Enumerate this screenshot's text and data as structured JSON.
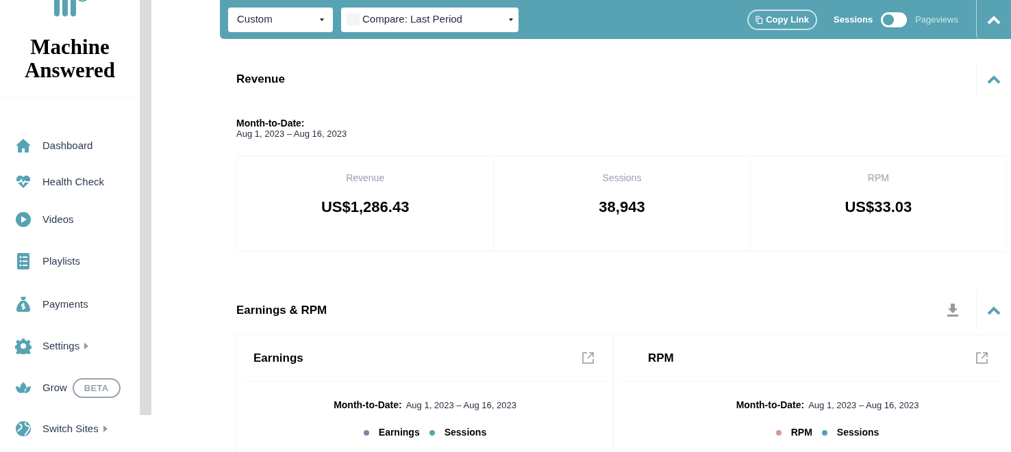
{
  "sidebar": {
    "logo_text": "Machine Answered",
    "items": [
      {
        "label": "Dashboard",
        "submenu": false
      },
      {
        "label": "Health Check",
        "submenu": false
      },
      {
        "label": "Videos",
        "submenu": false
      },
      {
        "label": "Playlists",
        "submenu": false
      },
      {
        "label": "Payments",
        "submenu": false
      },
      {
        "label": "Settings",
        "submenu": true
      },
      {
        "label": "Grow",
        "submenu": false,
        "badge": "BETA"
      },
      {
        "label": "Switch Sites",
        "submenu": true
      }
    ]
  },
  "toolbar": {
    "date_range": "Custom",
    "compare": {
      "label": "Compare: Last Period",
      "checked": false
    },
    "copy_link": "Copy Link",
    "toggle": {
      "left": "Sessions",
      "right": "Pageviews",
      "on": false
    }
  },
  "revenue": {
    "title": "Revenue",
    "period_label": "Month-to-Date:",
    "period_dates": "Aug 1, 2023 – Aug 16, 2023",
    "stats": [
      {
        "label": "Revenue",
        "value": "US$1,286.43"
      },
      {
        "label": "Sessions",
        "value": "38,943"
      },
      {
        "label": "RPM",
        "value": "US$33.03"
      }
    ]
  },
  "earnings_rpm": {
    "title": "Earnings & RPM",
    "cards": [
      {
        "title": "Earnings",
        "period_label": "Month-to-Date:",
        "period_dates": "Aug 1, 2023 – Aug 16, 2023",
        "legend": [
          {
            "label": "Earnings",
            "color": "#8a7fa3"
          },
          {
            "label": "Sessions",
            "color": "#57a3b3"
          }
        ]
      },
      {
        "title": "RPM",
        "period_label": "Month-to-Date:",
        "period_dates": "Aug 1, 2023 – Aug 16, 2023",
        "legend": [
          {
            "label": "RPM",
            "color": "#d9968f"
          },
          {
            "label": "Sessions",
            "color": "#57a3b3"
          }
        ]
      }
    ]
  }
}
